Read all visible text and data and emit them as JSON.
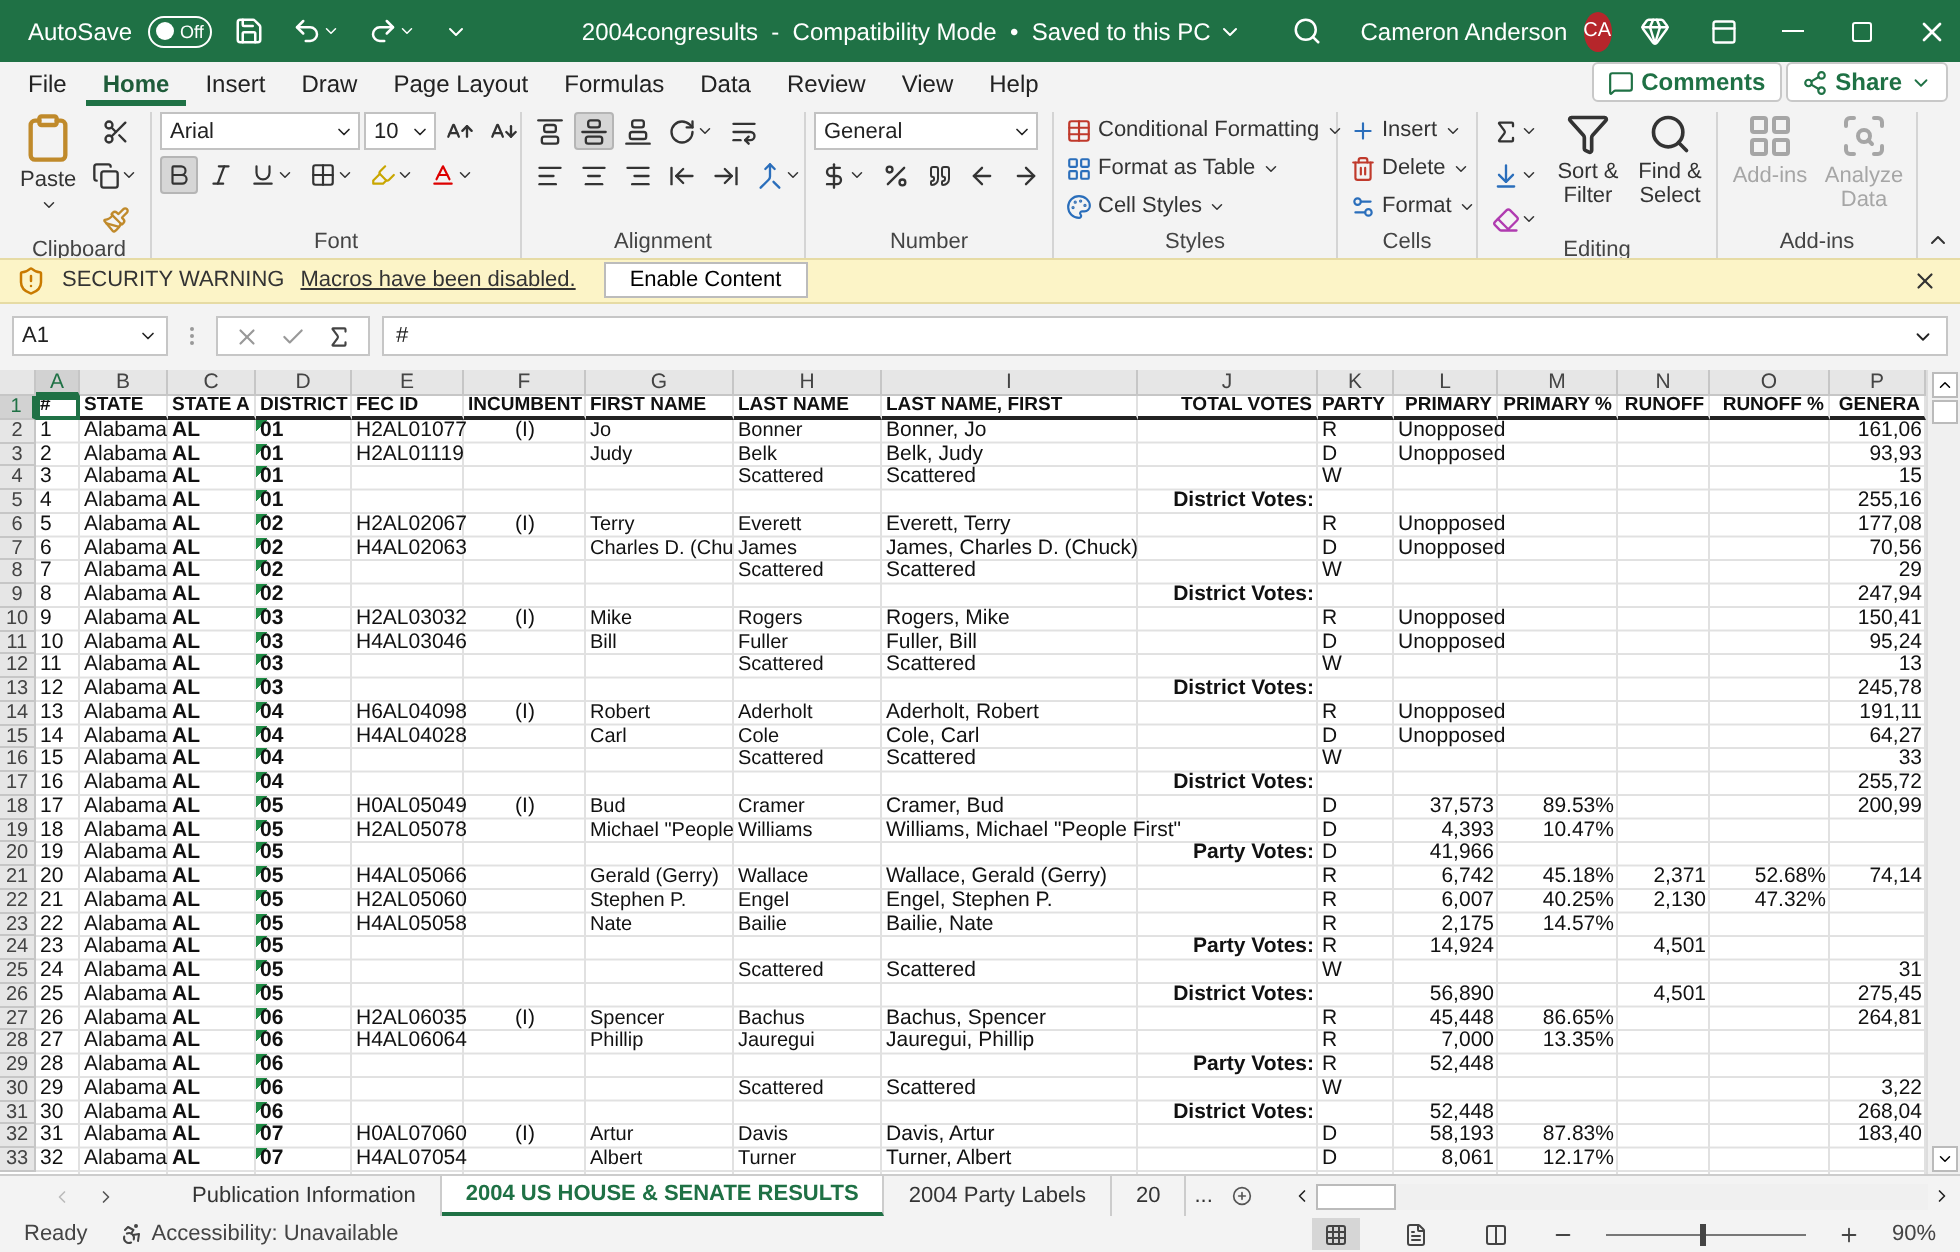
{
  "title_bar": {
    "autosave_label": "AutoSave",
    "autosave_on": false,
    "autosave_state": "Off",
    "document_title": "2004congresults  -  Compatibility Mode  •  Saved to this PC",
    "user_name": "Cameron Anderson",
    "user_initials": "CA"
  },
  "menu_tabs": [
    {
      "label": "File",
      "selected": false
    },
    {
      "label": "Home",
      "selected": true
    },
    {
      "label": "Insert",
      "selected": false
    },
    {
      "label": "Draw",
      "selected": false
    },
    {
      "label": "Page Layout",
      "selected": false
    },
    {
      "label": "Formulas",
      "selected": false
    },
    {
      "label": "Data",
      "selected": false
    },
    {
      "label": "Review",
      "selected": false
    },
    {
      "label": "View",
      "selected": false
    },
    {
      "label": "Help",
      "selected": false
    }
  ],
  "comments_button": "Comments",
  "share_button": "Share",
  "ribbon": {
    "clipboard": {
      "label": "Clipboard",
      "paste": "Paste"
    },
    "font": {
      "label": "Font",
      "name": "Arial",
      "size": "10",
      "bold": true
    },
    "alignment": {
      "label": "Alignment",
      "middle_align": true
    },
    "number": {
      "label": "Number",
      "format": "General"
    },
    "styles": {
      "label": "Styles",
      "buttons": [
        "Conditional Formatting",
        "Format as Table",
        "Cell Styles"
      ]
    },
    "cells": {
      "label": "Cells",
      "buttons": [
        "Insert",
        "Delete",
        "Format"
      ]
    },
    "editing": {
      "label": "Editing",
      "buttons": [
        "Sort & Filter",
        "Find & Select"
      ]
    },
    "addins": {
      "label": "Add-ins",
      "buttons": [
        {
          "label": "Add-ins",
          "disabled": true
        },
        {
          "label": "Analyze Data",
          "disabled": true
        }
      ]
    }
  },
  "security_bar": {
    "title": "SECURITY WARNING",
    "message": "Macros have been disabled.",
    "button": "Enable Content"
  },
  "formula_bar": {
    "name_box": "A1",
    "formula": "#"
  },
  "sheet": {
    "columns": [
      {
        "letter": "A",
        "selected": true
      },
      {
        "letter": "B",
        "selected": false
      },
      {
        "letter": "C",
        "selected": false
      },
      {
        "letter": "D",
        "selected": false
      },
      {
        "letter": "E",
        "selected": false
      },
      {
        "letter": "F",
        "selected": false
      },
      {
        "letter": "G",
        "selected": false
      },
      {
        "letter": "H",
        "selected": false
      },
      {
        "letter": "I",
        "selected": false
      },
      {
        "letter": "J",
        "selected": false
      },
      {
        "letter": "K",
        "selected": false
      },
      {
        "letter": "L",
        "selected": false
      },
      {
        "letter": "M",
        "selected": false
      },
      {
        "letter": "N",
        "selected": false
      },
      {
        "letter": "O",
        "selected": false
      },
      {
        "letter": "P",
        "selected": false
      }
    ],
    "rows": [
      {
        "number": "1",
        "selected": true,
        "cells": [
          "#",
          "STATE",
          "STATE A",
          "DISTRICT",
          "FEC ID",
          "INCUMBENT",
          "FIRST NAME",
          "LAST NAME",
          "LAST NAME, FIRST",
          "TOTAL VOTES",
          "PARTY",
          "PRIMARY",
          "PRIMARY %",
          "RUNOFF",
          "RUNOFF %",
          "GENERA"
        ]
      },
      {
        "number": "2",
        "selected": false,
        "cells": [
          "1",
          "Alabama",
          "AL",
          "01",
          "H2AL01077",
          "(I)",
          "Jo",
          "Bonner",
          "Bonner, Jo",
          "",
          "R",
          "Unopposed",
          "",
          "",
          "",
          "161,06"
        ]
      },
      {
        "number": "3",
        "selected": false,
        "cells": [
          "2",
          "Alabama",
          "AL",
          "01",
          "H2AL01119",
          "",
          "Judy",
          "Belk",
          "Belk, Judy",
          "",
          "D",
          "Unopposed",
          "",
          "",
          "",
          "93,93"
        ]
      },
      {
        "number": "4",
        "selected": false,
        "cells": [
          "3",
          "Alabama",
          "AL",
          "01",
          "",
          "",
          "",
          "Scattered",
          "Scattered",
          "",
          "W",
          "",
          "",
          "",
          "",
          "15"
        ]
      },
      {
        "number": "5",
        "selected": false,
        "cells": [
          "4",
          "Alabama",
          "AL",
          "01",
          "",
          "",
          "",
          "",
          "",
          "District Votes:",
          "",
          "",
          "",
          "",
          "",
          "255,16"
        ]
      },
      {
        "number": "6",
        "selected": false,
        "cells": [
          "5",
          "Alabama",
          "AL",
          "02",
          "H2AL02067",
          "(I)",
          "Terry",
          "Everett",
          "Everett, Terry",
          "",
          "R",
          "Unopposed",
          "",
          "",
          "",
          "177,08"
        ]
      },
      {
        "number": "7",
        "selected": false,
        "cells": [
          "6",
          "Alabama",
          "AL",
          "02",
          "H4AL02063",
          "",
          "Charles D. (Chu",
          "James",
          "James, Charles D. (Chuck)",
          "",
          "D",
          "Unopposed",
          "",
          "",
          "",
          "70,56"
        ]
      },
      {
        "number": "8",
        "selected": false,
        "cells": [
          "7",
          "Alabama",
          "AL",
          "02",
          "",
          "",
          "",
          "Scattered",
          "Scattered",
          "",
          "W",
          "",
          "",
          "",
          "",
          "29"
        ]
      },
      {
        "number": "9",
        "selected": false,
        "cells": [
          "8",
          "Alabama",
          "AL",
          "02",
          "",
          "",
          "",
          "",
          "",
          "District Votes:",
          "",
          "",
          "",
          "",
          "",
          "247,94"
        ]
      },
      {
        "number": "10",
        "selected": false,
        "cells": [
          "9",
          "Alabama",
          "AL",
          "03",
          "H2AL03032",
          "(I)",
          "Mike",
          "Rogers",
          "Rogers, Mike",
          "",
          "R",
          "Unopposed",
          "",
          "",
          "",
          "150,41"
        ]
      },
      {
        "number": "11",
        "selected": false,
        "cells": [
          "10",
          "Alabama",
          "AL",
          "03",
          "H4AL03046",
          "",
          "Bill",
          "Fuller",
          "Fuller, Bill",
          "",
          "D",
          "Unopposed",
          "",
          "",
          "",
          "95,24"
        ]
      },
      {
        "number": "12",
        "selected": false,
        "cells": [
          "11",
          "Alabama",
          "AL",
          "03",
          "",
          "",
          "",
          "Scattered",
          "Scattered",
          "",
          "W",
          "",
          "",
          "",
          "",
          "13"
        ]
      },
      {
        "number": "13",
        "selected": false,
        "cells": [
          "12",
          "Alabama",
          "AL",
          "03",
          "",
          "",
          "",
          "",
          "",
          "District Votes:",
          "",
          "",
          "",
          "",
          "",
          "245,78"
        ]
      },
      {
        "number": "14",
        "selected": false,
        "cells": [
          "13",
          "Alabama",
          "AL",
          "04",
          "H6AL04098",
          "(I)",
          "Robert",
          "Aderholt",
          "Aderholt, Robert",
          "",
          "R",
          "Unopposed",
          "",
          "",
          "",
          "191,11"
        ]
      },
      {
        "number": "15",
        "selected": false,
        "cells": [
          "14",
          "Alabama",
          "AL",
          "04",
          "H4AL04028",
          "",
          "Carl",
          "Cole",
          "Cole, Carl",
          "",
          "D",
          "Unopposed",
          "",
          "",
          "",
          "64,27"
        ]
      },
      {
        "number": "16",
        "selected": false,
        "cells": [
          "15",
          "Alabama",
          "AL",
          "04",
          "",
          "",
          "",
          "Scattered",
          "Scattered",
          "",
          "W",
          "",
          "",
          "",
          "",
          "33"
        ]
      },
      {
        "number": "17",
        "selected": false,
        "cells": [
          "16",
          "Alabama",
          "AL",
          "04",
          "",
          "",
          "",
          "",
          "",
          "District Votes:",
          "",
          "",
          "",
          "",
          "",
          "255,72"
        ]
      },
      {
        "number": "18",
        "selected": false,
        "cells": [
          "17",
          "Alabama",
          "AL",
          "05",
          "H0AL05049",
          "(I)",
          "Bud",
          "Cramer",
          "Cramer, Bud",
          "",
          "D",
          "37,573",
          "89.53%",
          "",
          "",
          "200,99"
        ]
      },
      {
        "number": "19",
        "selected": false,
        "cells": [
          "18",
          "Alabama",
          "AL",
          "05",
          "H2AL05078",
          "",
          "Michael \"People",
          "Williams",
          "Williams, Michael \"People First\"",
          "",
          "D",
          "4,393",
          "10.47%",
          "",
          "",
          ""
        ]
      },
      {
        "number": "20",
        "selected": false,
        "cells": [
          "19",
          "Alabama",
          "AL",
          "05",
          "",
          "",
          "",
          "",
          "",
          "Party Votes:",
          "D",
          "41,966",
          "",
          "",
          "",
          ""
        ]
      },
      {
        "number": "21",
        "selected": false,
        "cells": [
          "20",
          "Alabama",
          "AL",
          "05",
          "H4AL05066",
          "",
          "Gerald (Gerry)",
          "Wallace",
          "Wallace, Gerald (Gerry)",
          "",
          "R",
          "6,742",
          "45.18%",
          "2,371",
          "52.68%",
          "74,14"
        ]
      },
      {
        "number": "22",
        "selected": false,
        "cells": [
          "21",
          "Alabama",
          "AL",
          "05",
          "H2AL05060",
          "",
          "Stephen P.",
          "Engel",
          "Engel, Stephen P.",
          "",
          "R",
          "6,007",
          "40.25%",
          "2,130",
          "47.32%",
          ""
        ]
      },
      {
        "number": "23",
        "selected": false,
        "cells": [
          "22",
          "Alabama",
          "AL",
          "05",
          "H4AL05058",
          "",
          "Nate",
          "Bailie",
          "Bailie, Nate",
          "",
          "R",
          "2,175",
          "14.57%",
          "",
          "",
          ""
        ]
      },
      {
        "number": "24",
        "selected": false,
        "cells": [
          "23",
          "Alabama",
          "AL",
          "05",
          "",
          "",
          "",
          "",
          "",
          "Party Votes:",
          "R",
          "14,924",
          "",
          "4,501",
          "",
          ""
        ]
      },
      {
        "number": "25",
        "selected": false,
        "cells": [
          "24",
          "Alabama",
          "AL",
          "05",
          "",
          "",
          "",
          "Scattered",
          "Scattered",
          "",
          "W",
          "",
          "",
          "",
          "",
          "31"
        ]
      },
      {
        "number": "26",
        "selected": false,
        "cells": [
          "25",
          "Alabama",
          "AL",
          "05",
          "",
          "",
          "",
          "",
          "",
          "District Votes:",
          "",
          "56,890",
          "",
          "4,501",
          "",
          "275,45"
        ]
      },
      {
        "number": "27",
        "selected": false,
        "cells": [
          "26",
          "Alabama",
          "AL",
          "06",
          "H2AL06035",
          "(I)",
          "Spencer",
          "Bachus",
          "Bachus, Spencer",
          "",
          "R",
          "45,448",
          "86.65%",
          "",
          "",
          "264,81"
        ]
      },
      {
        "number": "28",
        "selected": false,
        "cells": [
          "27",
          "Alabama",
          "AL",
          "06",
          "H4AL06064",
          "",
          "Phillip",
          "Jauregui",
          "Jauregui, Phillip",
          "",
          "R",
          "7,000",
          "13.35%",
          "",
          "",
          ""
        ]
      },
      {
        "number": "29",
        "selected": false,
        "cells": [
          "28",
          "Alabama",
          "AL",
          "06",
          "",
          "",
          "",
          "",
          "",
          "Party Votes:",
          "R",
          "52,448",
          "",
          "",
          "",
          ""
        ]
      },
      {
        "number": "30",
        "selected": false,
        "cells": [
          "29",
          "Alabama",
          "AL",
          "06",
          "",
          "",
          "",
          "Scattered",
          "Scattered",
          "",
          "W",
          "",
          "",
          "",
          "",
          "3,22"
        ]
      },
      {
        "number": "31",
        "selected": false,
        "cells": [
          "30",
          "Alabama",
          "AL",
          "06",
          "",
          "",
          "",
          "",
          "",
          "District Votes:",
          "",
          "52,448",
          "",
          "",
          "",
          "268,04"
        ]
      },
      {
        "number": "32",
        "selected": false,
        "cells": [
          "31",
          "Alabama",
          "AL",
          "07",
          "H0AL07060",
          "(I)",
          "Artur",
          "Davis",
          "Davis, Artur",
          "",
          "D",
          "58,193",
          "87.83%",
          "",
          "",
          "183,40"
        ]
      },
      {
        "number": "33",
        "selected": false,
        "cells": [
          "32",
          "Alabama",
          "AL",
          "07",
          "H4AL07054",
          "",
          "Albert",
          "Turner",
          "Turner, Albert",
          "",
          "D",
          "8,061",
          "12.17%",
          "",
          "",
          ""
        ]
      }
    ]
  },
  "sheet_tabs": [
    {
      "label": "Publication Information",
      "selected": false
    },
    {
      "label": "2004 US HOUSE & SENATE RESULTS",
      "selected": true
    },
    {
      "label": "2004 Party Labels",
      "selected": false
    },
    {
      "label": "20",
      "selected": false
    }
  ],
  "more_tabs": "...",
  "status_bar": {
    "ready": "Ready",
    "accessibility": "Accessibility: Unavailable",
    "views": [
      {
        "kind": "normal",
        "selected": true
      },
      {
        "kind": "page_layout",
        "selected": false
      },
      {
        "kind": "page_break",
        "selected": false
      }
    ],
    "level": 0.47,
    "zoom": "90%"
  }
}
